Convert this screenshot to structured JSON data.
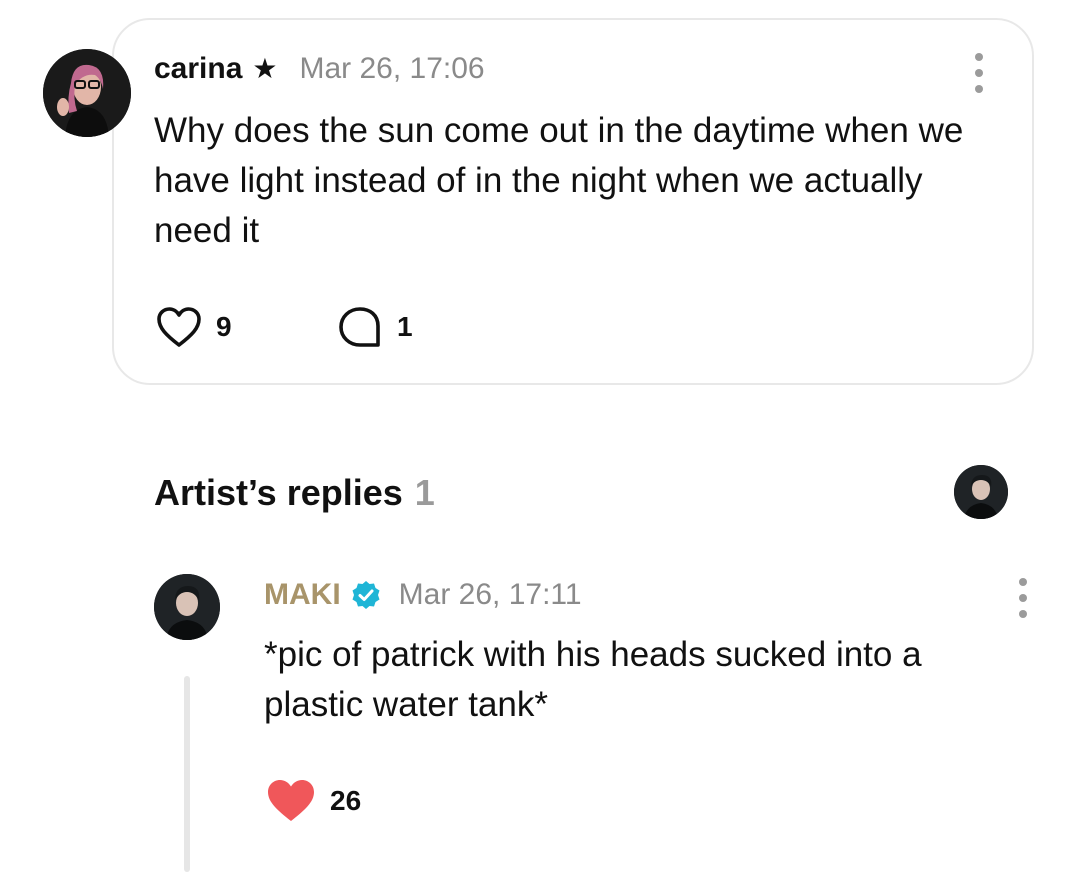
{
  "post": {
    "username": "carina",
    "badge_icon": "star-icon",
    "timestamp": "Mar 26, 17:06",
    "text": "Why does the sun come out in the daytime when we have light instead of in the night when we actually need it",
    "likes": "9",
    "comments": "1"
  },
  "replies_section": {
    "title": "Artist’s replies",
    "count": "1"
  },
  "reply": {
    "username": "MAKI",
    "verified_icon": "verified-badge-icon",
    "timestamp": "Mar 26, 17:11",
    "text": "*pic of patrick with his heads sucked into a plastic water tank*",
    "likes": "26"
  },
  "colors": {
    "artist_name": "#a8946a",
    "verified": "#1fb5d6",
    "liked_heart": "#f0575a",
    "muted_text": "#8a8a8a"
  }
}
